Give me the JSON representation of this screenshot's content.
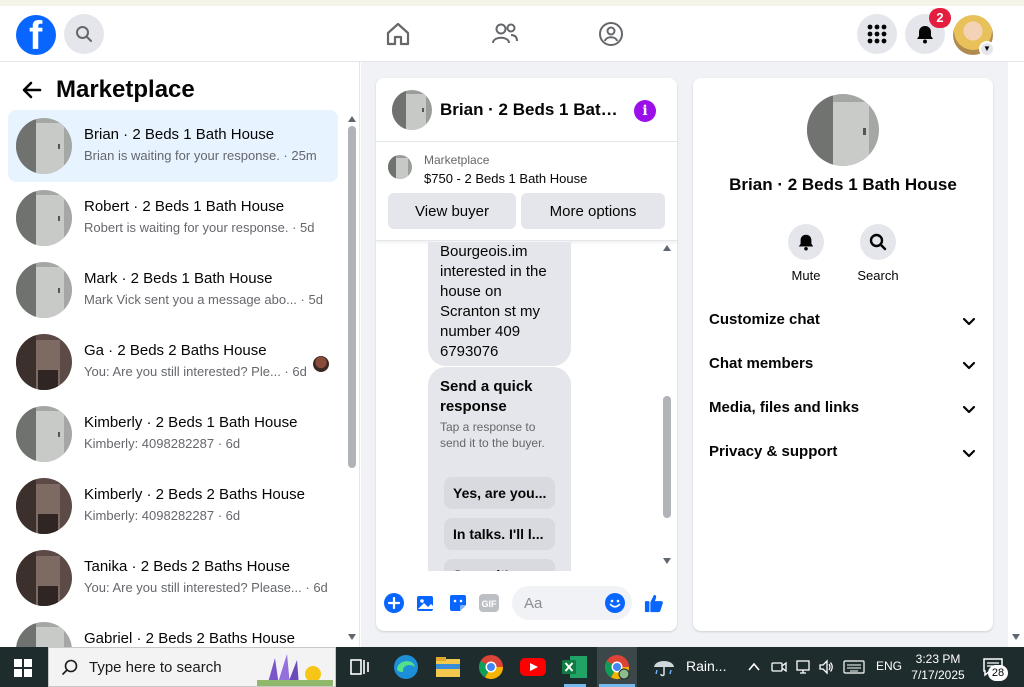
{
  "top_nav": {
    "notification_count": "2"
  },
  "marketplace": {
    "title": "Marketplace"
  },
  "conversations": [
    {
      "title": "Brian · 2 Beds 1 Bath House",
      "snippet": "Brian is waiting for your response. · 25m",
      "active": true,
      "bold": false
    },
    {
      "title": "Robert · 2 Beds 1 Bath House",
      "snippet": "Robert is waiting for your response. · 5d",
      "active": false,
      "bold": false
    },
    {
      "title": "Mark · 2 Beds 1 Bath House",
      "snippet": "Mark Vick sent you a message abo... · 5d",
      "active": false,
      "bold": false
    },
    {
      "title": "Ga · 2 Beds 2 Baths House",
      "snippet": "You: Are you still interested? Ple... · 6d",
      "active": false,
      "bold": false,
      "seen_avatar": true
    },
    {
      "title": "Kimberly · 2 Beds 1 Bath House",
      "snippet": "Kimberly: 4098282287 · 6d",
      "active": false,
      "bold": false
    },
    {
      "title": "Kimberly · 2 Beds 2 Baths House",
      "snippet": "Kimberly: 4098282287 · 6d",
      "active": false,
      "bold": false
    },
    {
      "title": "Tanika · 2 Beds 2 Baths House",
      "snippet": "You: Are you still interested? Please... · 6d",
      "active": false,
      "bold": false
    },
    {
      "title": "Gabriel · 2 Beds 2 Baths House",
      "snippet": "",
      "active": false,
      "bold": false
    }
  ],
  "chat": {
    "header_title": "Brian · 2 Beds 1 Bath House",
    "listing_source": "Marketplace",
    "listing_price": "$750 - 2 Beds 1 Bath House",
    "view_buyer_label": "View buyer",
    "more_options_label": "More options",
    "received_message": "Bourgeois.im interested in the house on Scranton st my number  409 6793076",
    "quick_response_title": "Send a quick response",
    "quick_response_sub": "Tap a response to send it to the buyer.",
    "quick_replies": [
      "Yes, are you...",
      "In talks. I'll l...",
      "Sorry, it's n..."
    ],
    "input_placeholder": "Aa"
  },
  "info_panel": {
    "title": "Brian · 2 Beds 1 Bath House",
    "mute_label": "Mute",
    "search_label": "Search",
    "sections": [
      "Customize chat",
      "Chat members",
      "Media, files and links",
      "Privacy & support"
    ]
  },
  "taskbar": {
    "search_placeholder": "Type here to search",
    "weather_text": "Rain...",
    "language": "ENG",
    "time": "3:23 PM",
    "date": "7/17/2025",
    "notification_count": "28"
  },
  "colors": {
    "brand_blue": "#0866ff",
    "messenger_purple": "#9b10e8",
    "badge_red": "#e41e3f",
    "selected_row": "#e7f3ff"
  }
}
